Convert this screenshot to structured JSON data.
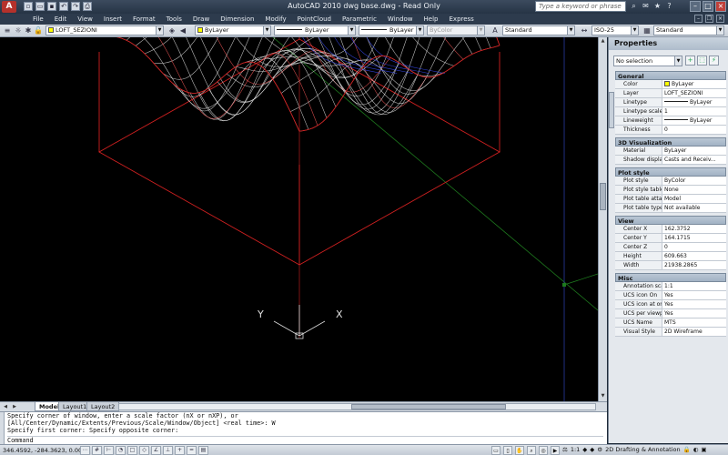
{
  "window": {
    "app_icon": "A",
    "title": "AutoCAD 2010    dwg base.dwg - Read Only",
    "help_search_placeholder": "Type a keyword or phrase"
  },
  "menu": [
    "File",
    "Edit",
    "View",
    "Insert",
    "Format",
    "Tools",
    "Draw",
    "Dimension",
    "Modify",
    "PointCloud",
    "Parametric",
    "Window",
    "Help",
    "Express"
  ],
  "properties_toolbar": {
    "layer": "LOFT_SEZIONI",
    "color": "ByLayer",
    "linetype": "ByLayer",
    "lineweight": "ByLayer",
    "plotstyle": "ByColor",
    "text_style": "Standard",
    "dim_style": "ISO-25",
    "table_style": "Standard"
  },
  "viewport": {
    "ucs_x": "X",
    "ucs_y": "Y",
    "colors": {
      "background": "#000000",
      "mesh_u": "#e8e8e8",
      "mesh_v": "#ff5a5a",
      "hidden": "#3a4cff",
      "box": "#d02020",
      "grid": "#1e7a1e"
    }
  },
  "layout_tabs": [
    "Model",
    "Layout1",
    "Layout2"
  ],
  "command_history": [
    "Specify corner of window, enter a scale factor (nX or nXP), or",
    "[All/Center/Dynamic/Extents/Previous/Scale/Window/Object] <real time>: W",
    "Specify first corner: Specify opposite corner:"
  ],
  "command_prompt": "Command",
  "status": {
    "coordinates": "346.4592, -284.3623, 0.0000",
    "annotation_scale": "1:1",
    "workspace": "2D Drafting & Annotation"
  },
  "properties_palette": {
    "header": "Properties",
    "selection": "No selection",
    "sections": [
      {
        "title": "General",
        "rows": [
          {
            "k": "Color",
            "v": "ByLayer",
            "swatch": true
          },
          {
            "k": "Layer",
            "v": "LOFT_SEZIONI"
          },
          {
            "k": "Linetype",
            "v": "ByLayer",
            "line": true
          },
          {
            "k": "Linetype scale",
            "v": "1"
          },
          {
            "k": "Lineweight",
            "v": "ByLayer",
            "line": true
          },
          {
            "k": "Thickness",
            "v": "0"
          }
        ]
      },
      {
        "title": "3D Visualization",
        "rows": [
          {
            "k": "Material",
            "v": "ByLayer"
          },
          {
            "k": "Shadow display",
            "v": "Casts and Receiv..."
          }
        ]
      },
      {
        "title": "Plot style",
        "rows": [
          {
            "k": "Plot style",
            "v": "ByColor"
          },
          {
            "k": "Plot style table",
            "v": "None"
          },
          {
            "k": "Plot table attac...",
            "v": "Model"
          },
          {
            "k": "Plot table type",
            "v": "Not available"
          }
        ]
      },
      {
        "title": "View",
        "rows": [
          {
            "k": "Center X",
            "v": "162.3752"
          },
          {
            "k": "Center Y",
            "v": "164.1715"
          },
          {
            "k": "Center Z",
            "v": "0"
          },
          {
            "k": "Height",
            "v": "609.663"
          },
          {
            "k": "Width",
            "v": "21938.2865"
          }
        ]
      },
      {
        "title": "Misc",
        "rows": [
          {
            "k": "Annotation scale",
            "v": "1:1"
          },
          {
            "k": "UCS icon On",
            "v": "Yes"
          },
          {
            "k": "UCS icon at origin",
            "v": "Yes"
          },
          {
            "k": "UCS per viewport",
            "v": "Yes"
          },
          {
            "k": "UCS Name",
            "v": "MTS"
          },
          {
            "k": "Visual Style",
            "v": "2D Wireframe"
          }
        ]
      }
    ]
  }
}
